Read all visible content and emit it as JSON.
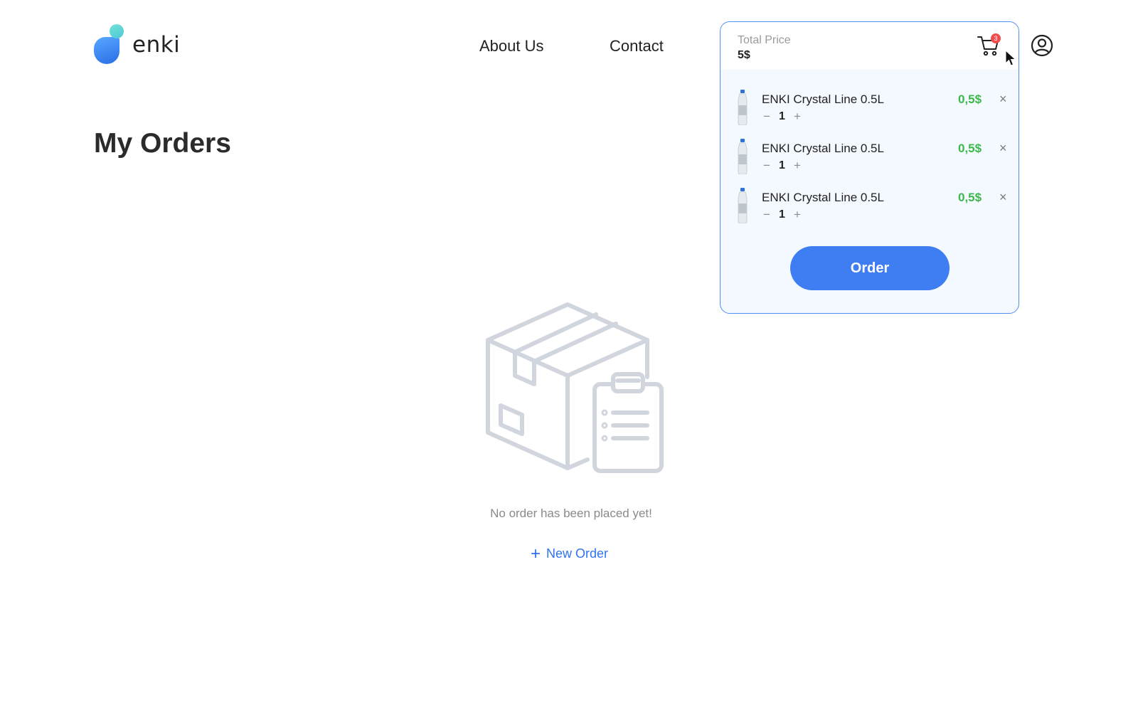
{
  "header": {
    "logo_text": "enki",
    "nav": [
      {
        "label": "About Us"
      },
      {
        "label": "Contact"
      }
    ]
  },
  "main": {
    "title": "My Orders",
    "empty_message": "No order has been placed yet!",
    "new_order_label": "New Order",
    "new_order_icon": "plus-icon"
  },
  "cart": {
    "total_label": "Total Price",
    "total_value": "5$",
    "badge_count": "3",
    "items": [
      {
        "name": "ENKI Crystal Line 0.5L",
        "quantity": "1",
        "price": "0,5$"
      },
      {
        "name": "ENKI Crystal Line 0.5L",
        "quantity": "1",
        "price": "0,5$"
      },
      {
        "name": "ENKI Crystal Line 0.5L",
        "quantity": "1",
        "price": "0,5$"
      }
    ],
    "decrement_symbol": "−",
    "increment_symbol": "+",
    "remove_symbol": "×",
    "order_button_label": "Order"
  },
  "colors": {
    "accent": "#3e7df2",
    "price": "#3cb94a",
    "badge": "#f04c4c",
    "panel_border": "#4f8ef3"
  }
}
